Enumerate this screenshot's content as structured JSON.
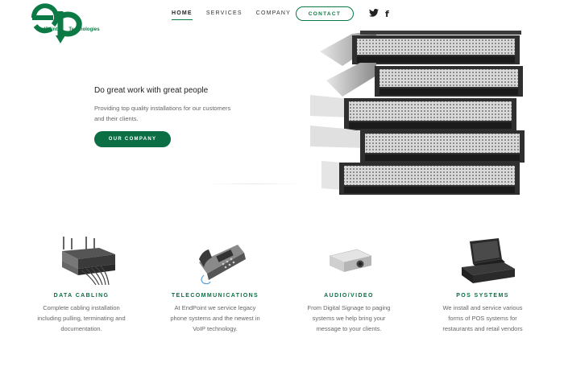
{
  "brand": {
    "logo_word_left": "EndPoint",
    "logo_word_right": "Technologies",
    "color": "#0b6e44"
  },
  "nav": {
    "items": [
      {
        "label": "HOME",
        "active": true
      },
      {
        "label": "SERVICES",
        "active": false
      },
      {
        "label": "COMPANY",
        "active": false
      }
    ],
    "contact_label": "CONTACT",
    "social": {
      "twitter_icon": "twitter-icon",
      "facebook_glyph": "f"
    }
  },
  "hero": {
    "title": "Do great work with great people",
    "subtitle": "Providing top quality installations for our customers and their clients.",
    "button_label": "OUR COMPANY",
    "image_icon": "server-rack-stack"
  },
  "services": [
    {
      "title": "DATA CABLING",
      "text": "Complete cabling installation including pulling, terminating and documentation.",
      "icon": "network-switch-icon"
    },
    {
      "title": "TELECOMMUNICATIONS",
      "text": "At EndPoint we service legacy phone systems and the newest in VoIP technology.",
      "icon": "desk-phone-icon"
    },
    {
      "title": "AUDIO/VIDEO",
      "text": "From Digital Signage to paging systems we help bring your message to your clients.",
      "icon": "projector-icon"
    },
    {
      "title": "POS SYSTEMS",
      "text": "We install and service various forms of POS systems for restaurants and retail vendors",
      "icon": "pos-terminal-icon"
    }
  ]
}
